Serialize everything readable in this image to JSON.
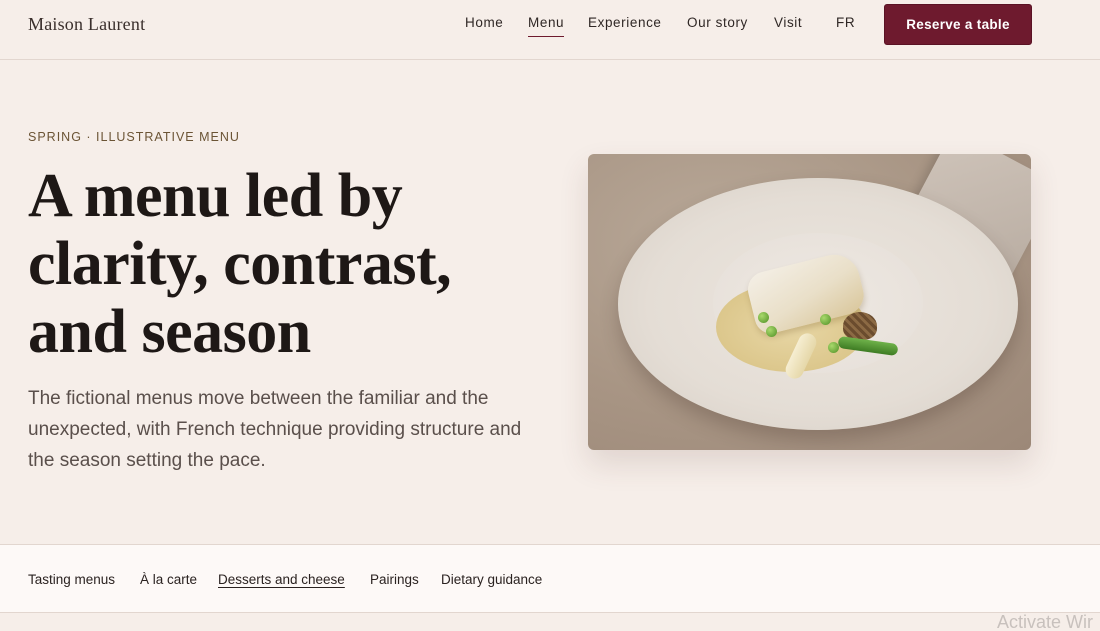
{
  "header": {
    "logo": "Maison Laurent",
    "nav": [
      {
        "label": "Home",
        "active": false
      },
      {
        "label": "Menu",
        "active": true
      },
      {
        "label": "Experience",
        "active": false
      },
      {
        "label": "Our story",
        "active": false
      },
      {
        "label": "Visit",
        "active": false
      },
      {
        "label": "FR",
        "active": false
      }
    ],
    "cta_label": "Reserve a table",
    "cta_color": "#6e1a2e"
  },
  "hero": {
    "eyebrow": "SPRING · ILLUSTRATIVE MENU",
    "headline_lines": [
      "A menu led by",
      "clarity, contrast,",
      "and season"
    ],
    "subcopy": "The fictional menus move between the familiar and the unexpected, with French technique providing structure and the season setting the pace.",
    "image_subject": "plated-fish-dish"
  },
  "subnav": {
    "items": [
      {
        "label": "Tasting menus",
        "active": false
      },
      {
        "label": "À la carte",
        "active": false
      },
      {
        "label": "Desserts and cheese",
        "active": true
      },
      {
        "label": "Pairings",
        "active": false
      },
      {
        "label": "Dietary guidance",
        "active": false
      }
    ]
  },
  "os_overlay": {
    "watermark": "Activate Wir"
  },
  "colors": {
    "background": "#f6eee9",
    "accent": "#6e1a2e",
    "eyebrow": "#6b5435"
  }
}
